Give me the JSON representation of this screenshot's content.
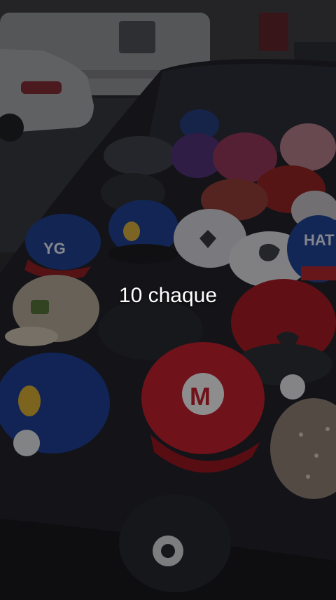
{
  "overlay": {
    "caption": "10 chaque"
  },
  "photo": {
    "subject": "photograph",
    "cap_logos": {
      "mario": "M",
      "navy_left": "YG",
      "navy_right": "HAT"
    }
  }
}
